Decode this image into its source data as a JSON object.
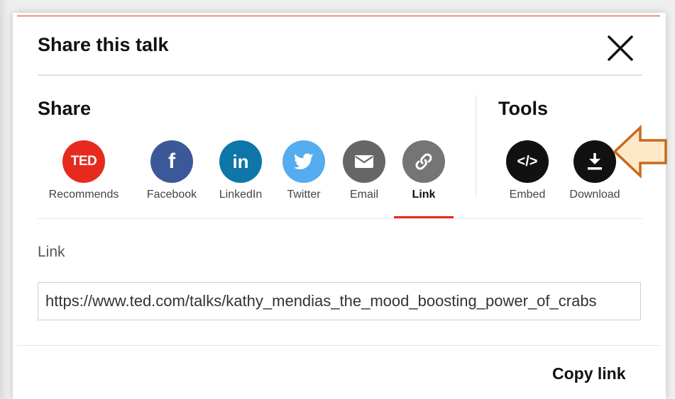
{
  "dialog": {
    "title": "Share this talk",
    "close_label": "Close"
  },
  "share": {
    "heading": "Share",
    "items": [
      {
        "label": "Recommends",
        "icon": "ted-icon",
        "color": "#e62b1e",
        "glyph": "TED"
      },
      {
        "label": "Facebook",
        "icon": "facebook-icon",
        "color": "#3b5998",
        "glyph": "f"
      },
      {
        "label": "LinkedIn",
        "icon": "linkedin-icon",
        "color": "#0e76a8",
        "glyph": "in"
      },
      {
        "label": "Twitter",
        "icon": "twitter-icon",
        "color": "#55acee",
        "glyph": ""
      },
      {
        "label": "Email",
        "icon": "email-icon",
        "color": "#666666",
        "glyph": ""
      },
      {
        "label": "Link",
        "icon": "link-icon",
        "color": "#757575",
        "glyph": ""
      }
    ],
    "active": "Link"
  },
  "tools": {
    "heading": "Tools",
    "items": [
      {
        "label": "Embed",
        "icon": "embed-icon",
        "color": "#111111",
        "glyph": "</>"
      },
      {
        "label": "Download",
        "icon": "download-icon",
        "color": "#111111",
        "glyph": ""
      }
    ]
  },
  "link_panel": {
    "label": "Link",
    "value": "https://www.ted.com/talks/kathy_mendias_the_mood_boosting_power_of_crabs",
    "copy_label": "Copy link"
  },
  "colors": {
    "accent": "#e62b1e",
    "arrow_fill": "#fde9c8",
    "arrow_stroke": "#c8691e"
  }
}
